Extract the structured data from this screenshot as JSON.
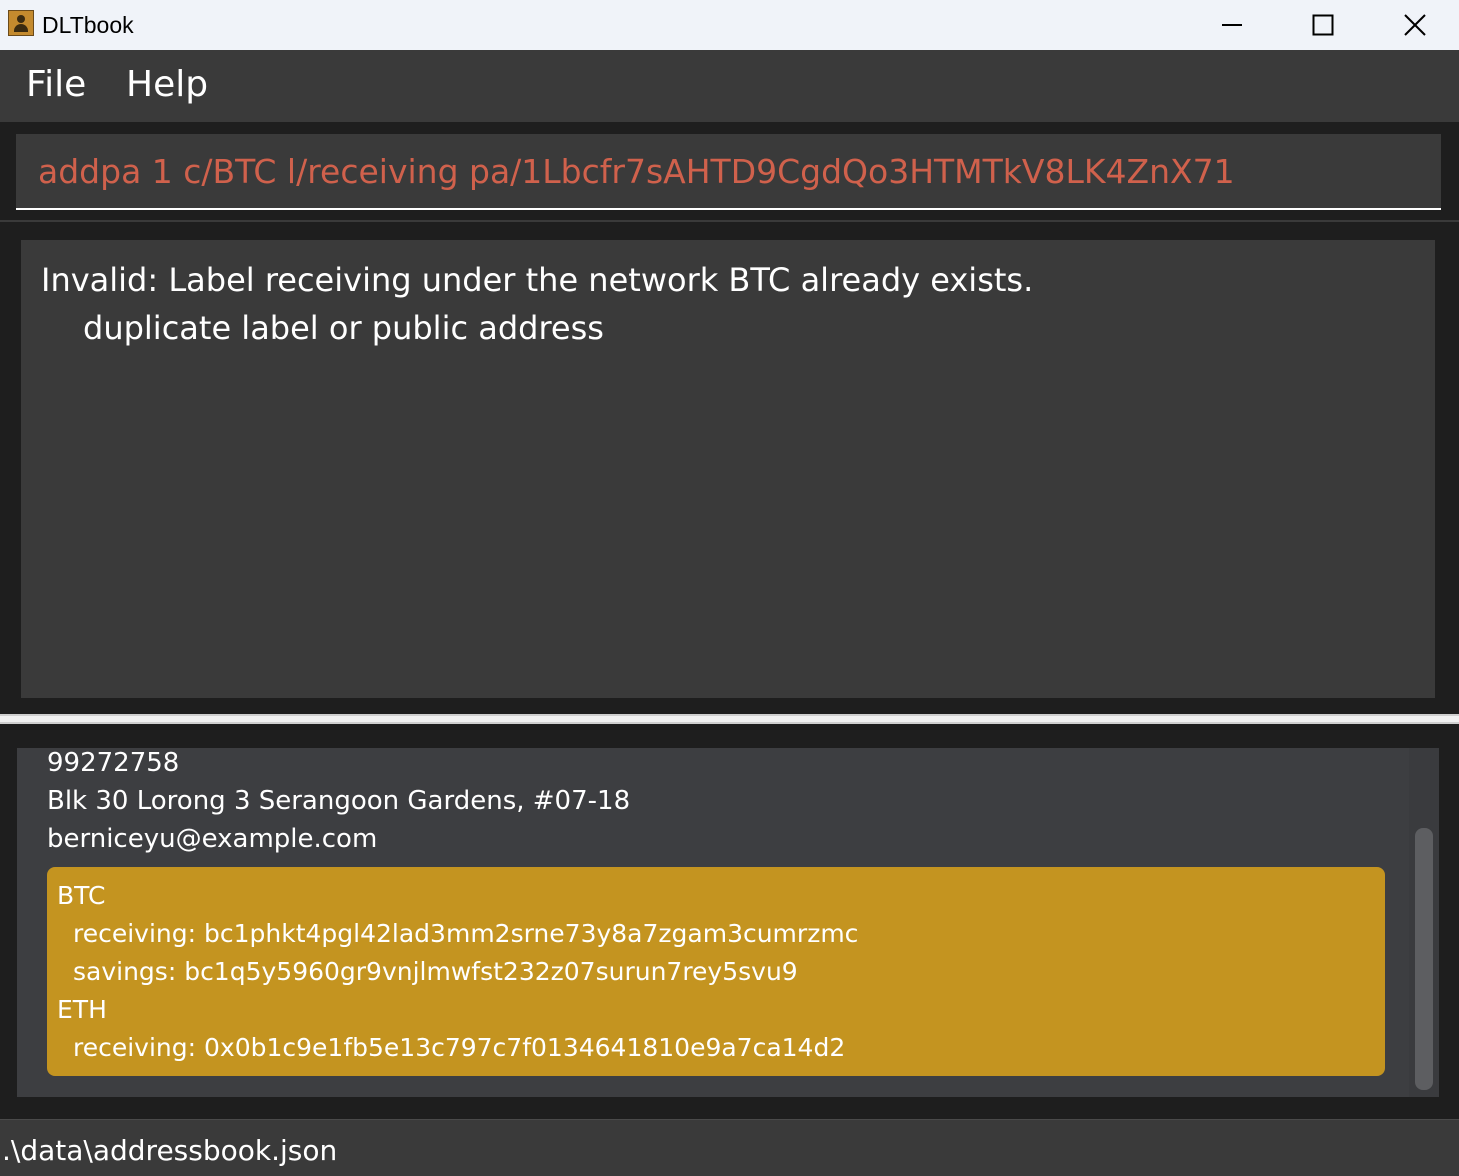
{
  "window": {
    "title": "DLTbook",
    "icon": "address-book-icon",
    "controls": [
      "minimize-icon",
      "maximize-icon",
      "close-icon"
    ]
  },
  "menu": {
    "items": [
      {
        "label": "File"
      },
      {
        "label": "Help"
      }
    ]
  },
  "command_box": {
    "value": "addpa 1 c/BTC l/receiving pa/1Lbcfr7sAHTD9CgdQo3HTMTkV8LK4ZnX71",
    "text_color": "#d0614c"
  },
  "result_display": {
    "line1": "Invalid: Label receiving under the network BTC already exists.",
    "line2": "duplicate label or public address"
  },
  "person_card": {
    "phone": "99272758",
    "address": "Blk 30 Lorong 3 Serangoon Gardens, #07-18",
    "email": "berniceyu@example.com",
    "wallets": {
      "btc_network": "BTC",
      "btc_receiving": "receiving: bc1phkt4pgl42lad3mm2srne73y8a7zgam3cumrzmc",
      "btc_savings": "savings: bc1q5y5960gr9vnjlmwfst232z07surun7rey5svu9",
      "eth_network": "ETH",
      "eth_receiving": "receiving: 0x0b1c9e1fb5e13c797c7f0134641810e9a7ca14d2"
    },
    "wallet_color": "#c49420"
  },
  "status_bar": {
    "file_path": ".\\data\\addressbook.json"
  }
}
